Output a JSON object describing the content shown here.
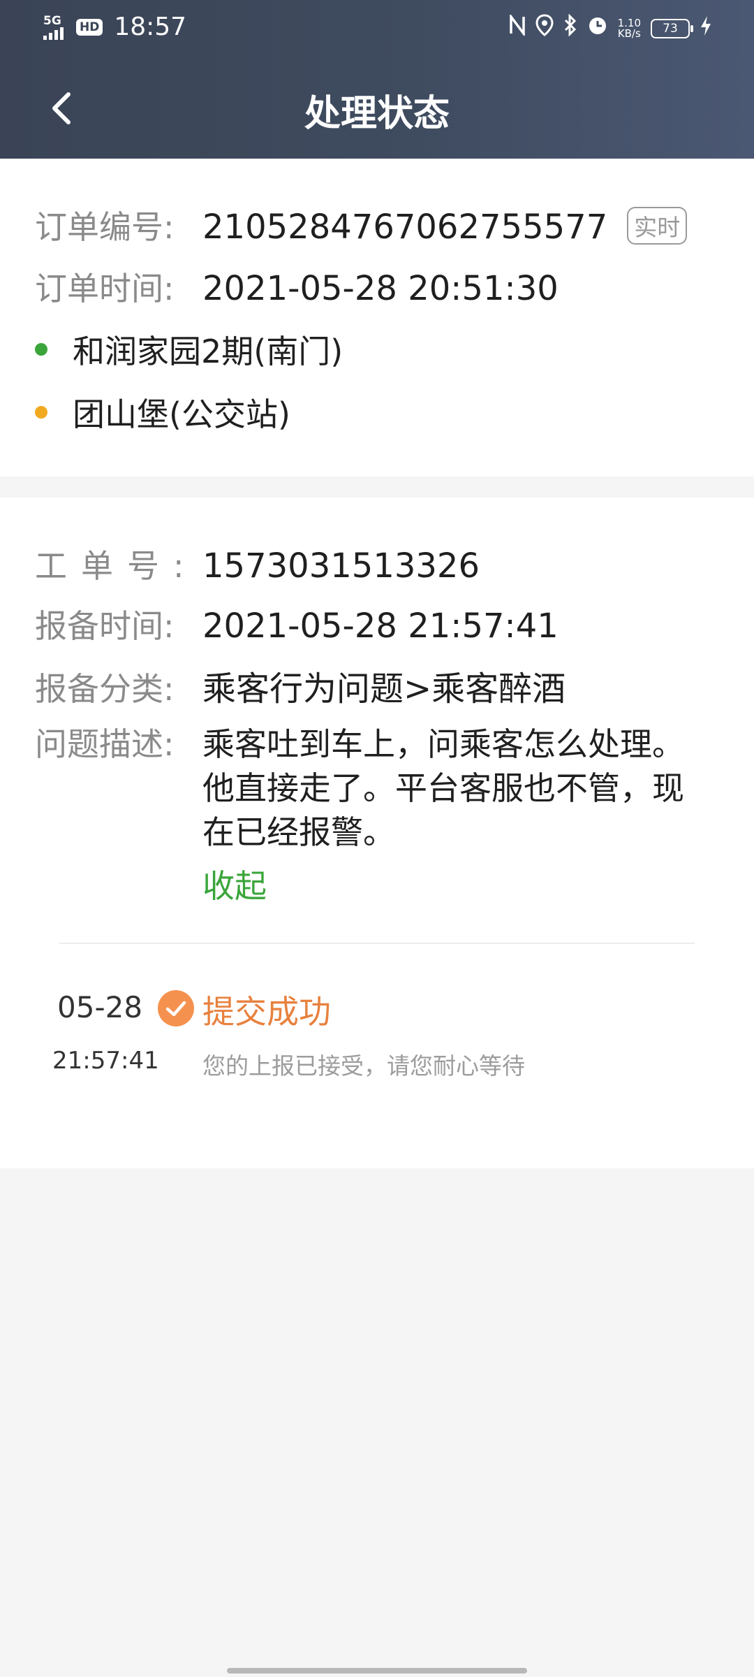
{
  "status_bar": {
    "network": "5G",
    "hd": "HD",
    "time": "18:57",
    "speed_value": "1.10",
    "speed_unit": "KB/s",
    "battery": "73"
  },
  "nav": {
    "title": "处理状态"
  },
  "order": {
    "number_label": "订单编号:",
    "number": "2105284767062755577",
    "badge": "实时",
    "time_label": "订单时间:",
    "time": "2021-05-28 20:51:30",
    "start": "和润家园2期(南门)",
    "end": "团山堡(公交站)",
    "start_color": "#3aa53a",
    "end_color": "#f1a91f"
  },
  "ticket": {
    "number_label": "工单号:",
    "number": "1573031513326",
    "report_time_label": "报备时间:",
    "report_time": "2021-05-28 21:57:41",
    "category_label": "报备分类:",
    "category": "乘客行为问题>乘客醉酒",
    "desc_label": "问题描述:",
    "desc": "乘客吐到车上，问乘客怎么处理。他直接走了。平台客服也不管，现在已经报警。",
    "collapse": "收起"
  },
  "timeline": {
    "date": "05-28",
    "time": "21:57:41",
    "status": "提交成功",
    "desc": "您的上报已接受，请您耐心等待",
    "status_color": "#e8813e"
  }
}
